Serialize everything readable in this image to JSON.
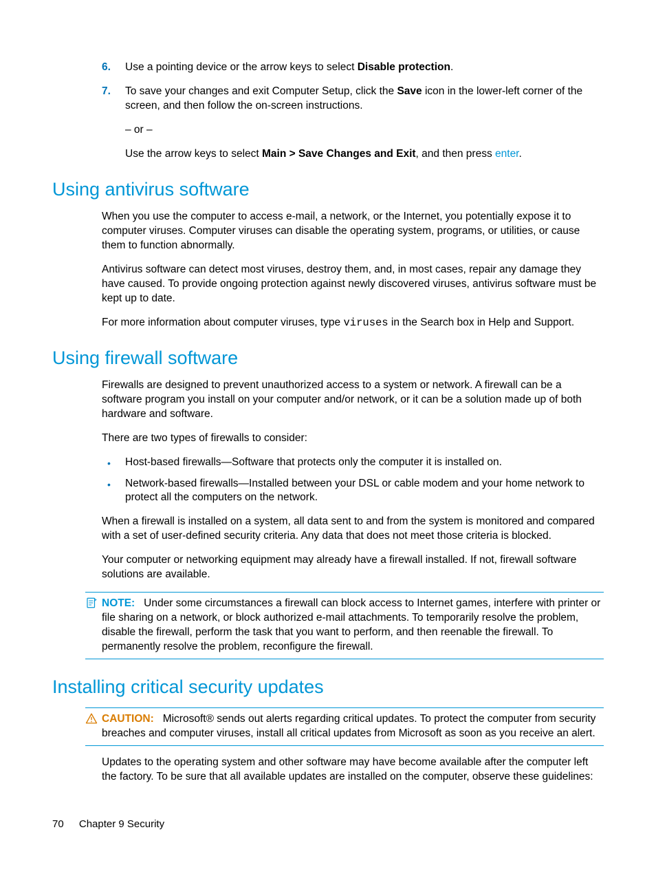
{
  "steps": {
    "six": {
      "num": "6.",
      "text_pre": "Use a pointing device or the arrow keys to select ",
      "bold": "Disable protection",
      "text_post": "."
    },
    "seven": {
      "num": "7.",
      "line1_pre": "To save your changes and exit Computer Setup, click the ",
      "line1_bold": "Save",
      "line1_post": " icon in the lower-left corner of the screen, and then follow the on-screen instructions.",
      "or": "– or –",
      "line2_pre": "Use the arrow keys to select ",
      "line2_bold": "Main > Save Changes and Exit",
      "line2_mid": ", and then press ",
      "line2_key": "enter",
      "line2_post": "."
    }
  },
  "antivirus": {
    "heading": "Using antivirus software",
    "p1": "When you use the computer to access e-mail, a network, or the Internet, you potentially expose it to computer viruses. Computer viruses can disable the operating system, programs, or utilities, or cause them to function abnormally.",
    "p2": "Antivirus software can detect most viruses, destroy them, and, in most cases, repair any damage they have caused. To provide ongoing protection against newly discovered viruses, antivirus software must be kept up to date.",
    "p3_pre": "For more information about computer viruses, type ",
    "p3_mono": "viruses",
    "p3_post": " in the Search box in Help and Support."
  },
  "firewall": {
    "heading": "Using firewall software",
    "p1": "Firewalls are designed to prevent unauthorized access to a system or network. A firewall can be a software program you install on your computer and/or network, or it can be a solution made up of both hardware and software.",
    "p2": "There are two types of firewalls to consider:",
    "b1": "Host-based firewalls—Software that protects only the computer it is installed on.",
    "b2": "Network-based firewalls—Installed between your DSL or cable modem and your home network to protect all the computers on the network.",
    "p3": "When a firewall is installed on a system, all data sent to and from the system is monitored and compared with a set of user-defined security criteria. Any data that does not meet those criteria is blocked.",
    "p4": "Your computer or networking equipment may already have a firewall installed. If not, firewall software solutions are available.",
    "note_label": "NOTE:",
    "note_body": "Under some circumstances a firewall can block access to Internet games, interfere with printer or file sharing on a network, or block authorized e-mail attachments. To temporarily resolve the problem, disable the firewall, perform the task that you want to perform, and then reenable the firewall. To permanently resolve the problem, reconfigure the firewall."
  },
  "updates": {
    "heading": "Installing critical security updates",
    "caution_label": "CAUTION:",
    "caution_body": "Microsoft® sends out alerts regarding critical updates. To protect the computer from security breaches and computer viruses, install all critical updates from Microsoft as soon as you receive an alert.",
    "p1": "Updates to the operating system and other software may have become available after the computer left the factory. To be sure that all available updates are installed on the computer, observe these guidelines:"
  },
  "footer": {
    "page": "70",
    "chapter": "Chapter 9   Security"
  }
}
